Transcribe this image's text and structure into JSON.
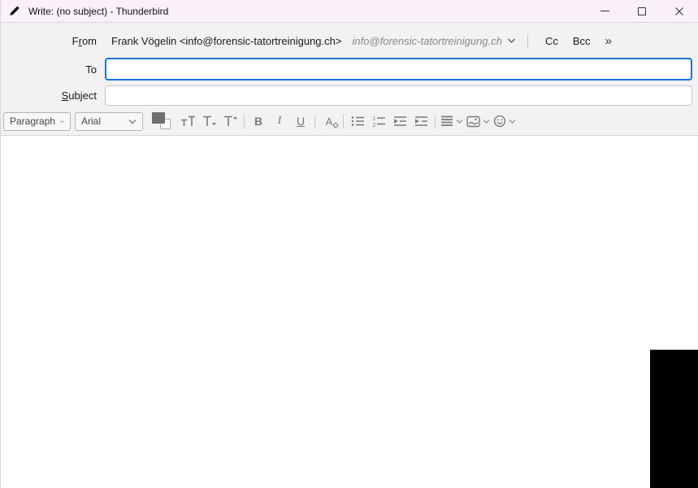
{
  "titlebar": {
    "title": "Write: (no subject) - Thunderbird"
  },
  "from_row": {
    "label": "From",
    "value": "Frank Vögelin <info@forensic-tatortreinigung.ch>",
    "identity": "info@forensic-tatortreinigung.ch",
    "cc_label": "Cc",
    "bcc_label": "Bcc",
    "more_label": "»"
  },
  "to_row": {
    "label": "To",
    "value": ""
  },
  "subject_row": {
    "label": "Subject",
    "value": ""
  },
  "toolbar": {
    "paragraph_select": "Paragraph",
    "font_select": "Arial",
    "bold_label": "B",
    "italic_label": "I",
    "underline_label": "U",
    "remove_format_label": "A"
  },
  "editor": {
    "content": ""
  },
  "colors": {
    "titlebar_bg": "#f9f0f8",
    "header_bg": "#f3f1f3",
    "focus_border": "#1373d9",
    "toolbar_icon": "#7a7a7a",
    "swatch_foreground": "#6f6f6f",
    "black_region": "#000000"
  }
}
